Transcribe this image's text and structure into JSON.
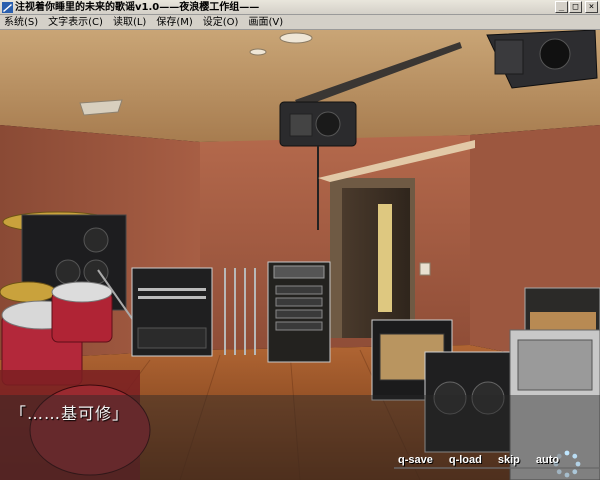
{
  "window": {
    "title": "注视着你睡里的未来的歌谣v1.0——夜浪樱工作组——",
    "controls": [
      "_",
      "□",
      "×"
    ]
  },
  "menubar": {
    "items": [
      "系统(S)",
      "文字表示(C)",
      "读取(L)",
      "保存(M)",
      "设定(O)",
      "画面(V)"
    ]
  },
  "dialogue": {
    "text": "「……基可修」"
  },
  "quick_menu": {
    "save": "q-save",
    "load": "q-load",
    "skip": "skip",
    "auto": "auto"
  },
  "scene": {
    "description_icon": "music-studio-background"
  }
}
